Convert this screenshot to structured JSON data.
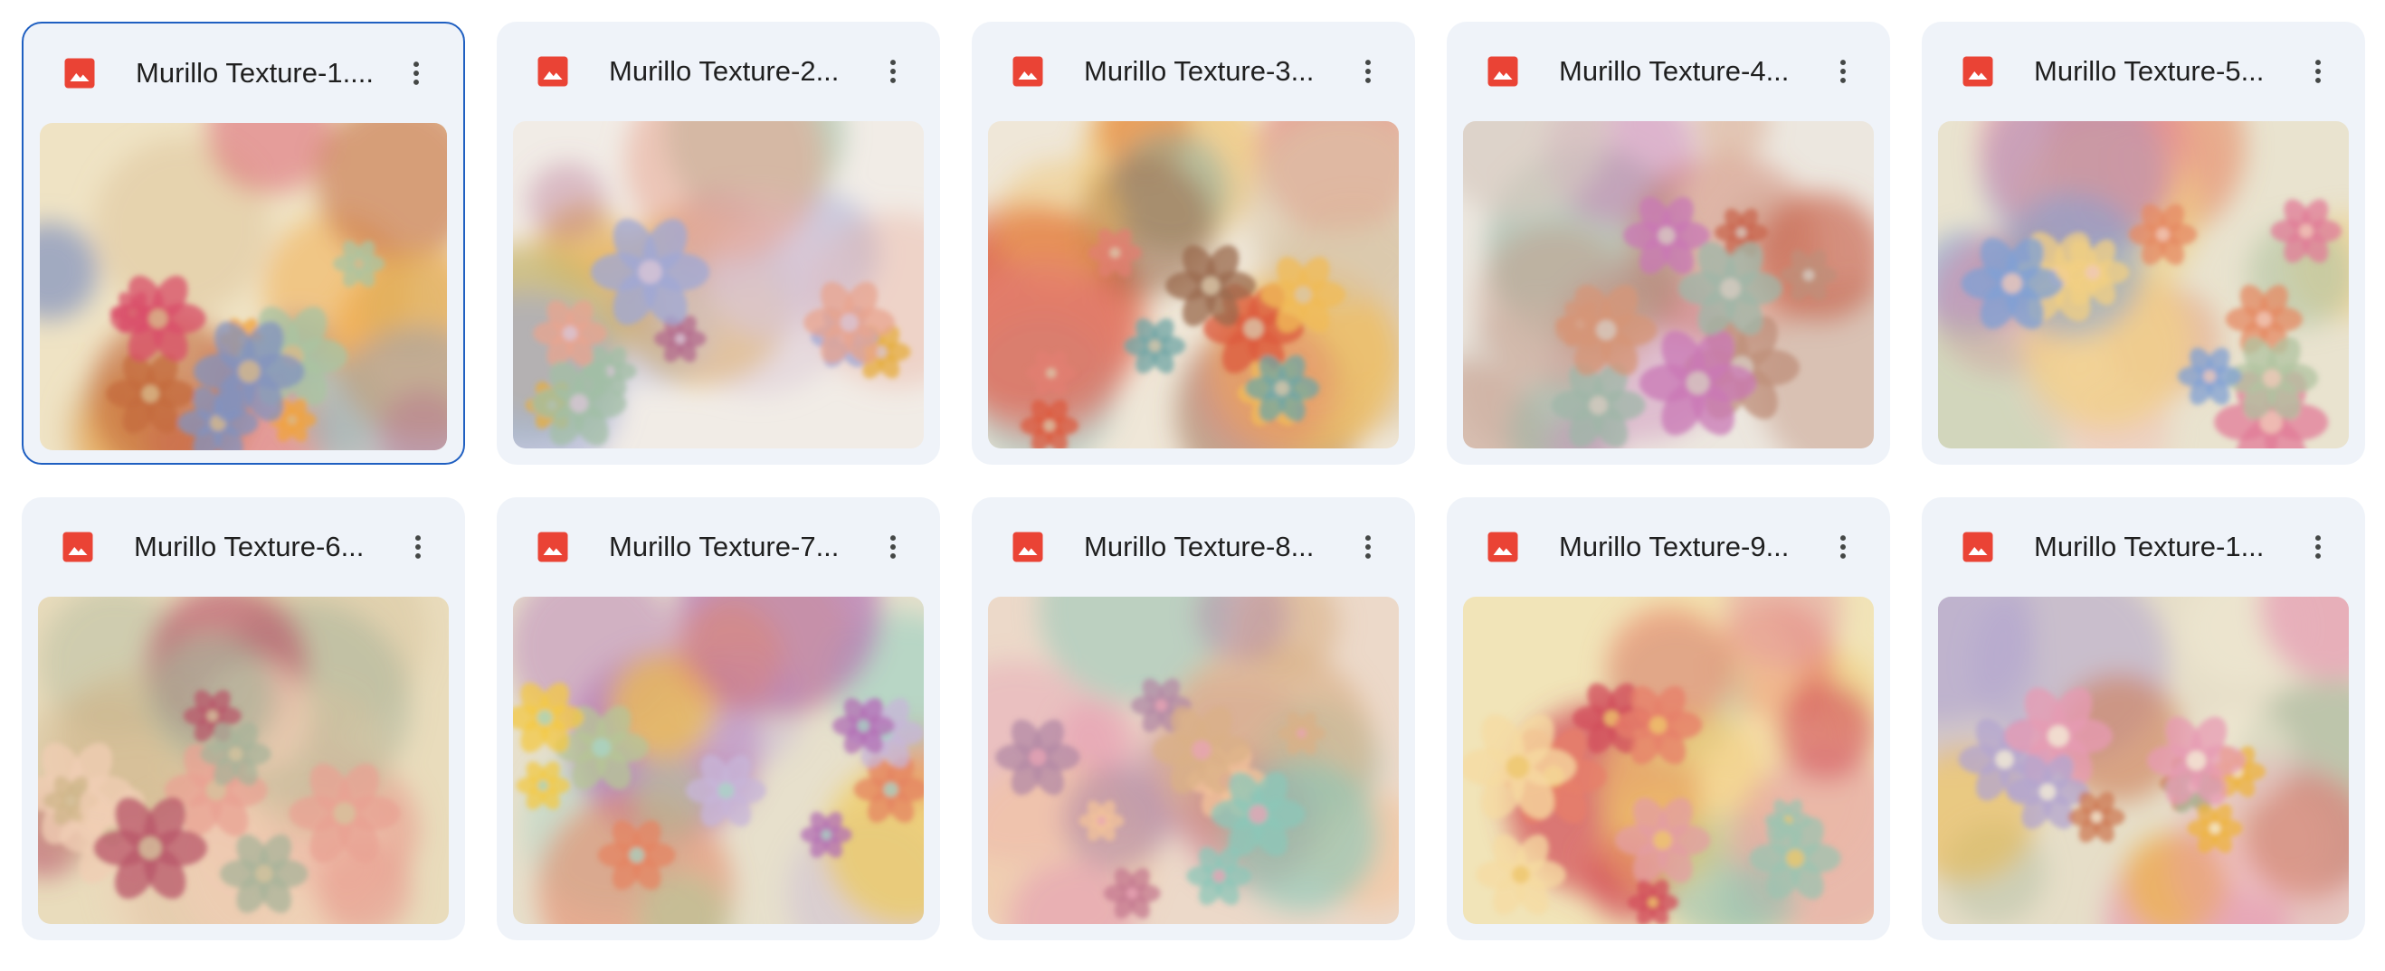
{
  "files": [
    {
      "title": "Murillo Texture-1....",
      "selected": true,
      "icon": "image-file-icon",
      "more_icon": "more-vert-icon",
      "palette": [
        "#efe3c4",
        "#d8b98a",
        "#f1a33b",
        "#d94f6a",
        "#8393bf",
        "#a9c4a2",
        "#c46b3f"
      ]
    },
    {
      "title": "Murillo Texture-2...",
      "selected": false,
      "icon": "image-file-icon",
      "more_icon": "more-vert-icon",
      "palette": [
        "#f1ece6",
        "#d9c6d6",
        "#e8a48f",
        "#e5ad3e",
        "#9fa8d6",
        "#a2bfa5",
        "#b36a8e"
      ]
    },
    {
      "title": "Murillo Texture-3...",
      "selected": false,
      "icon": "image-file-icon",
      "more_icon": "more-vert-icon",
      "palette": [
        "#efe7d8",
        "#d9c7aa",
        "#dc5a3c",
        "#f0bb57",
        "#e27f72",
        "#6fa6a6",
        "#9a6a4e"
      ]
    },
    {
      "title": "Murillo Texture-4...",
      "selected": false,
      "icon": "image-file-icon",
      "more_icon": "more-vert-icon",
      "palette": [
        "#ece7df",
        "#d7cbc0",
        "#d59578",
        "#c978b5",
        "#bf8f7a",
        "#9fb7a8",
        "#c9664d"
      ]
    },
    {
      "title": "Murillo Texture-5...",
      "selected": false,
      "icon": "image-file-icon",
      "more_icon": "more-vert-icon",
      "palette": [
        "#e9e3cf",
        "#f0c8b8",
        "#e58a63",
        "#f1cf83",
        "#7fa0d4",
        "#e27b98",
        "#b0c3a0"
      ]
    },
    {
      "title": "Murillo Texture-6...",
      "selected": false,
      "icon": "image-file-icon",
      "more_icon": "more-vert-icon",
      "palette": [
        "#e9dcbc",
        "#d6c39e",
        "#e8a193",
        "#f0cdb4",
        "#a8b39a",
        "#b8556a",
        "#cfb58a"
      ]
    },
    {
      "title": "Murillo Texture-7...",
      "selected": false,
      "icon": "image-file-icon",
      "more_icon": "more-vert-icon",
      "palette": [
        "#e7e0cc",
        "#a9d3c4",
        "#f3c843",
        "#b36fb4",
        "#e48462",
        "#c7b5d8",
        "#b6c596"
      ]
    },
    {
      "title": "Murillo Texture-8...",
      "selected": false,
      "icon": "image-file-icon",
      "more_icon": "more-vert-icon",
      "palette": [
        "#ecd9c9",
        "#e7a4b4",
        "#f3c39a",
        "#8cc7b8",
        "#b38aa6",
        "#d9b087",
        "#c47990"
      ]
    },
    {
      "title": "Murillo Texture-9...",
      "selected": false,
      "icon": "image-file-icon",
      "more_icon": "more-vert-icon",
      "palette": [
        "#f1e4b8",
        "#eec56b",
        "#e77f69",
        "#d24e5b",
        "#9cc3b0",
        "#f6dba1",
        "#e39da3"
      ]
    },
    {
      "title": "Murillo Texture-1...",
      "selected": false,
      "icon": "image-file-icon",
      "more_icon": "more-vert-icon",
      "palette": [
        "#e6dec8",
        "#f4ecd6",
        "#eeb43c",
        "#b3a5cf",
        "#e79bb3",
        "#cd7a54",
        "#a9b89c"
      ]
    }
  ],
  "colors": {
    "card_bg": "#eff3f9",
    "selected_border": "#1f5fc1",
    "icon_red": "#ea4335",
    "title_text": "#1f1f1f",
    "more_icon": "#444746"
  }
}
